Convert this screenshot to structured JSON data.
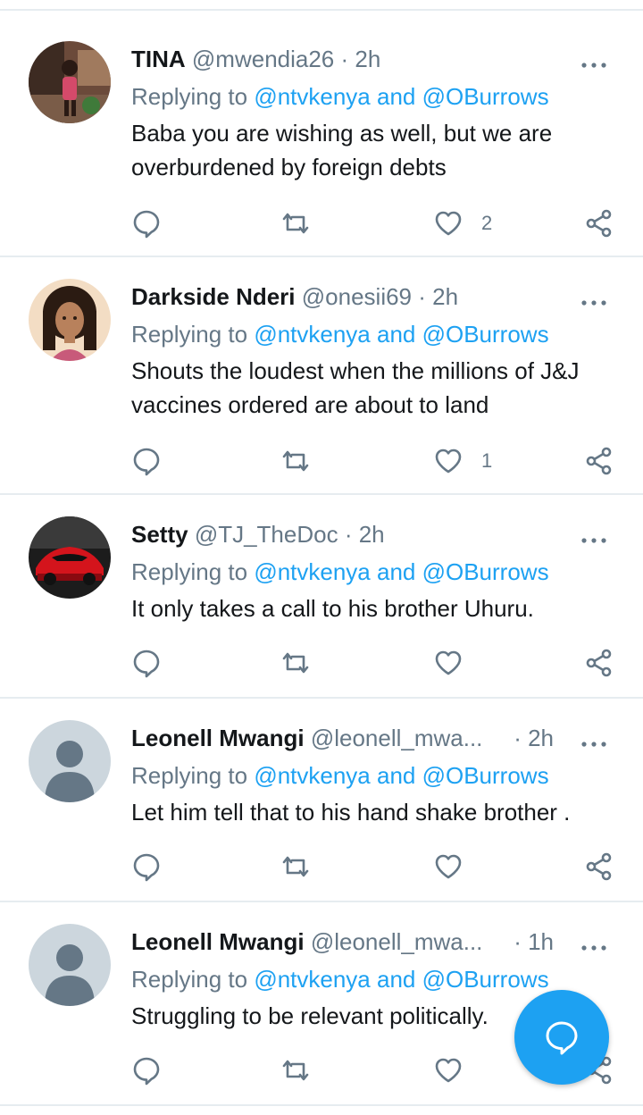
{
  "replying_prefix": "Replying to",
  "replying_mentions": "@ntvkenya and @OBurrows",
  "colors": {
    "accent": "#1da1f2",
    "secondary_text": "#657786",
    "primary_text": "#14171a",
    "divider": "#e6ecf0"
  },
  "tweets": [
    {
      "name": "TINA",
      "handle": "@mwendia26",
      "dot": " · ",
      "time": "2h",
      "text": "Baba you are wishing as well, but we are overburdened by foreign debts",
      "likes": "2",
      "avatar": "photo-woman-icon"
    },
    {
      "name": "Darkside Nderi",
      "handle": "@onesii69",
      "dot": " · ",
      "time": "2h",
      "text": "Shouts the loudest when the millions of J&J vaccines ordered are about to land",
      "likes": "1",
      "avatar": "illustrated-woman-icon"
    },
    {
      "name": "Setty",
      "handle": "@TJ_TheDoc",
      "dot": " · ",
      "time": "2h",
      "text": "It only takes a call to his brother  Uhuru.",
      "likes": "",
      "avatar": "red-car-icon"
    },
    {
      "name": "Leonell Mwangi",
      "handle": "@leonell_mwa...",
      "dot": "· ",
      "time": "2h",
      "text": "Let him tell that to his hand shake brother .",
      "likes": "",
      "avatar": "default-avatar-icon"
    },
    {
      "name": "Leonell Mwangi",
      "handle": "@leonell_mwa...",
      "dot": "· ",
      "time": "1h",
      "text": "Struggling to be relevant politically.",
      "likes": "",
      "avatar": "default-avatar-icon"
    }
  ],
  "fab": {
    "icon": "compose-reply-icon"
  }
}
